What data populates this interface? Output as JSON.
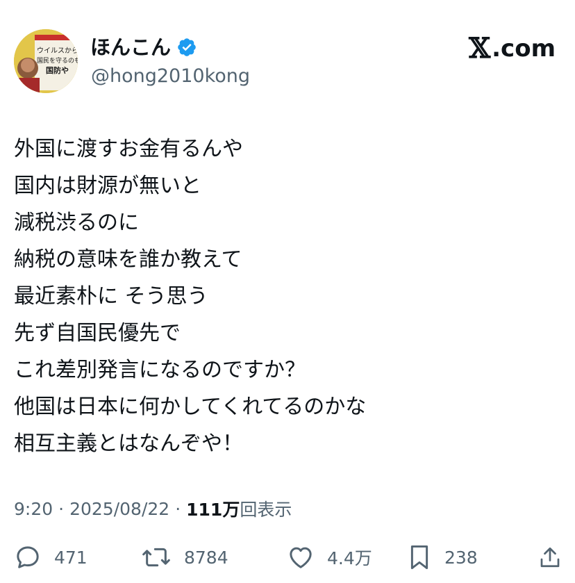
{
  "author": {
    "display_name": "ほんこん",
    "handle": "@hong2010kong",
    "avatar_icon": "profile-photo-book-cover",
    "avatar_book_text": [
      "ウイルスから",
      "国民を守るのも",
      "国防や"
    ],
    "verified_icon": "verified-badge-icon"
  },
  "brand": {
    "x": "𝕏",
    "domain": ".com"
  },
  "tweet": {
    "lines": [
      "外国に渡すお金有るんや",
      "国内は財源が無いと",
      "減税渋るのに",
      "納税の意味を誰か教えて",
      "最近素朴に そう思う",
      "先ず自国民優先で",
      "これ差別発言になるのですか？",
      "他国は日本に何かしてくれてるのかな",
      "相互主義とはなんぞや！"
    ]
  },
  "meta": {
    "time": "9:20",
    "separator": "·",
    "date": "2025/08/22",
    "views_count": "111万",
    "views_label": "回表示"
  },
  "actions": {
    "reply": {
      "count": "471",
      "icon": "reply-icon"
    },
    "repost": {
      "count": "8784",
      "icon": "repost-icon"
    },
    "like": {
      "count": "4.4万",
      "icon": "heart-icon"
    },
    "bookmark": {
      "count": "238",
      "icon": "bookmark-icon"
    },
    "share": {
      "icon": "share-icon"
    }
  },
  "colors": {
    "text_primary": "#0f1419",
    "text_secondary": "#536471",
    "verified_blue": "#1d9bf0",
    "background": "#ffffff"
  }
}
